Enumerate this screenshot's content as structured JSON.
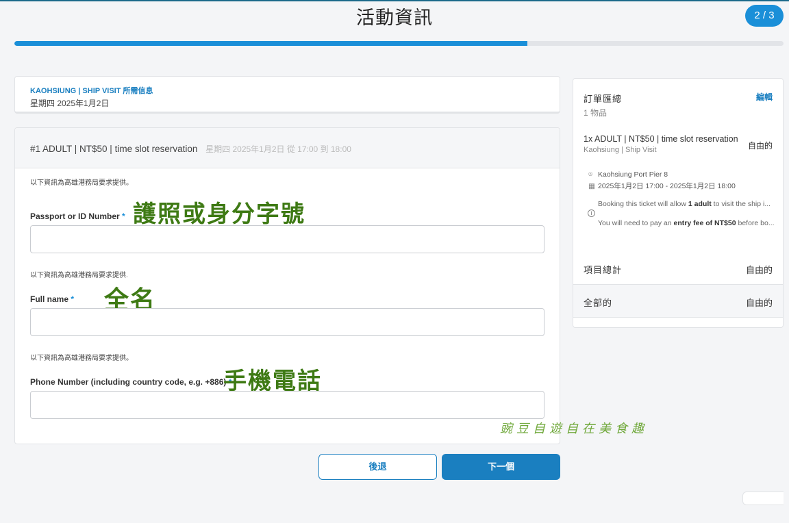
{
  "header": {
    "title": "活動資訊",
    "step_badge": "2 / 3",
    "progress_fraction": 0.667
  },
  "event": {
    "name": "KAOHSIUNG | SHIP VISIT 所需信息",
    "date": "星期四 2025年1月2日"
  },
  "form": {
    "ticket_title": "#1 ADULT | NT$50 | time slot reservation",
    "ticket_time": "星期四 2025年1月2日 從 17:00 到 18:00",
    "required_mark": "*",
    "fields": [
      {
        "note": "以下資訊為高雄港務局要求提供。",
        "label": "Passport or ID Number",
        "annotation": "護照或身分字號",
        "value": ""
      },
      {
        "note": "以下資訊為高雄港務局要求提供.",
        "label": "Full name",
        "annotation": "全名",
        "value": ""
      },
      {
        "note": "以下資訊為高雄港務局要求提供。",
        "label": "Phone Number (including country code, e.g. +886)",
        "annotation": "手機電話",
        "value": ""
      }
    ]
  },
  "buttons": {
    "back": "後退",
    "next": "下一個"
  },
  "summary": {
    "title": "訂單匯總",
    "edit": "編輯",
    "count": "1 物品",
    "item": {
      "title": "1x ADULT | NT$50 | time slot reservation",
      "subtitle": "Kaohsiung | Ship Visit",
      "price": "自由的",
      "location": "Kaohsiung Port Pier 8",
      "datetime": "2025年1月2日 17:00 - 2025年1月2日 18:00",
      "desc1_pre": "Booking this ticket will allow ",
      "desc1_bold": "1 adult",
      "desc1_post": " to visit the ship i...",
      "desc2_pre": "You will need to pay an ",
      "desc2_bold": "entry fee of NT$50",
      "desc2_post": " before bo..."
    },
    "subtotal_label": "項目總計",
    "subtotal_value": "自由的",
    "total_label": "全部的",
    "total_value": "自由的"
  },
  "watermark": "豌豆自遊自在美食趣",
  "icons": [
    "location-pin-icon",
    "calendar-icon",
    "info-icon"
  ]
}
